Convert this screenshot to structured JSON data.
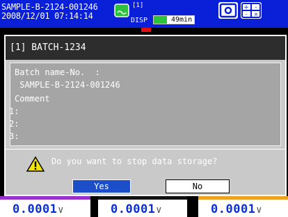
{
  "status": {
    "batch_id": "SAMPLE-B-2124-001246",
    "datetime": "2008/12/01 07:14:14",
    "memory_label": "[1]",
    "disp_label": "DISP",
    "time_remaining": "49min",
    "time_fill_fraction": 0.32,
    "icons": [
      "memory-card-icon",
      "snapshot-icon",
      "calculation-icon"
    ]
  },
  "dialog": {
    "title": "[1] BATCH-1234",
    "batch_label": "Batch name-No.  :",
    "batch_value": " SAMPLE-B-2124-001246",
    "comment_label": "Comment",
    "comment_lines": [
      "1:",
      "2:",
      "3:"
    ],
    "question": "Do you want to stop data storage?",
    "yes_label": "Yes",
    "no_label": "No"
  },
  "readouts": [
    {
      "value": "0.0001",
      "unit": "V",
      "color": "#9a2fc9"
    },
    {
      "value": "0.0001",
      "unit": "V",
      "color": "#111111"
    },
    {
      "value": "0.0001",
      "unit": "V",
      "color": "#f0a020"
    }
  ],
  "colors": {
    "status_bg": "#0a1fd8",
    "dialog_bg": "#c9c9c9",
    "title_bg": "#2d2d2d",
    "yes_bg": "#1b4ec8",
    "progress_fill": "#2cc23c"
  }
}
